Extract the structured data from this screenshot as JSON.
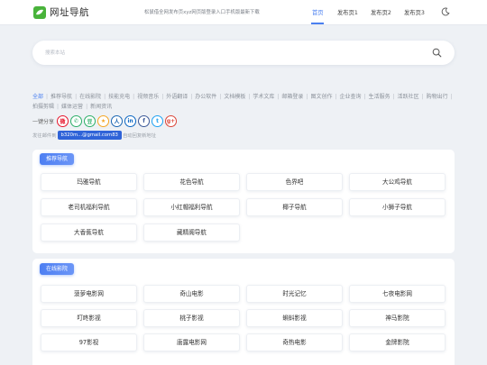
{
  "header": {
    "site_title": "网址导航",
    "notice": "松鼠借全网发布页xyz网页版登录入口手机版最新下载",
    "nav": [
      {
        "label": "首页",
        "active": true
      },
      {
        "label": "发布页1",
        "active": false
      },
      {
        "label": "发布页2",
        "active": false
      },
      {
        "label": "发布页3",
        "active": false
      }
    ],
    "theme_icon": "moon-icon"
  },
  "search": {
    "placeholder": "搜索本站",
    "icon": "search-icon"
  },
  "categories": [
    {
      "label": "全部",
      "active": true
    },
    {
      "label": "推荐导航"
    },
    {
      "label": "在线影院"
    },
    {
      "label": "技能充电"
    },
    {
      "label": "视频音乐"
    },
    {
      "label": "外语翻译"
    },
    {
      "label": "办公软件"
    },
    {
      "label": "文档模板"
    },
    {
      "label": "学术文库"
    },
    {
      "label": "邮箱登录"
    },
    {
      "label": "图文创作"
    },
    {
      "label": "企业查询"
    },
    {
      "label": "生活服务"
    },
    {
      "label": "活跃社区"
    },
    {
      "label": "购物出行"
    },
    {
      "label": "拍摄剪辑"
    },
    {
      "label": "媒体运营"
    },
    {
      "label": "新闻资讯"
    }
  ],
  "share": {
    "label": "一键分享",
    "buttons": [
      {
        "name": "weibo-icon",
        "glyph": "微",
        "color": "#e6162d"
      },
      {
        "name": "wechat-icon",
        "glyph": "✆",
        "color": "#2aae67"
      },
      {
        "name": "douban-icon",
        "glyph": "豆",
        "color": "#2aae67"
      },
      {
        "name": "qzone-icon",
        "glyph": "★",
        "color": "#f5a623"
      },
      {
        "name": "renren-icon",
        "glyph": "人",
        "color": "#1a66b3"
      },
      {
        "name": "linkedin-icon",
        "glyph": "in",
        "color": "#0a66c2"
      },
      {
        "name": "facebook-icon",
        "glyph": "f",
        "color": "#3b5998"
      },
      {
        "name": "twitter-icon",
        "glyph": "t",
        "color": "#1da1f2"
      },
      {
        "name": "google-plus-icon",
        "glyph": "g+",
        "color": "#db4437"
      }
    ]
  },
  "email": {
    "prefix": "发往邮件到",
    "address": "b320m...@gmail.com83",
    "suffix": "自动回复新地址"
  },
  "sections": [
    {
      "title": "推荐导航",
      "items": [
        "玛雅导航",
        "花色导航",
        "色界吧",
        "大公鸡导航",
        "老司机福利导航",
        "小红帽福利导航",
        "椰子导航",
        "小狮子导航",
        "大香蕉导航",
        "藏精阁导航"
      ]
    },
    {
      "title": "在线影院",
      "items": [
        "菠萝电影网",
        "奇山电影",
        "时光记忆",
        "七夜电影网",
        "叮咚影视",
        "桃子影视",
        "蝌蚪影视",
        "神马影院",
        "97影视",
        "唐露电影网",
        "奇热电影",
        "金牌影院"
      ]
    }
  ],
  "colors": {
    "accent": "#4a7ff0",
    "logo_green": "#49b33b",
    "page_bg": "#eef1f5"
  }
}
